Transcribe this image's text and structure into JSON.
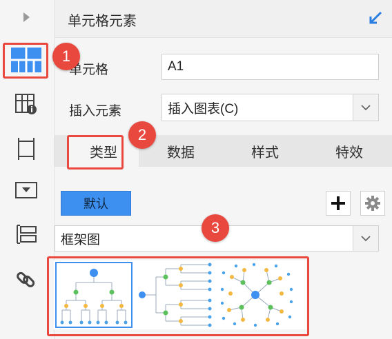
{
  "panel": {
    "title": "单元格元素"
  },
  "fields": {
    "cell_label": "单元格",
    "cell_value": "A1",
    "insert_label": "插入元素",
    "insert_value": "插入图表(C)"
  },
  "tabs": [
    {
      "label": "类型",
      "active": true
    },
    {
      "label": "数据",
      "active": false
    },
    {
      "label": "样式",
      "active": false
    },
    {
      "label": "特效",
      "active": false
    }
  ],
  "toolbar": {
    "default_label": "默认",
    "add_icon": "plus-icon",
    "settings_icon": "gear-icon"
  },
  "chart_type": {
    "value": "框架图"
  },
  "thumbnails": [
    {
      "name": "tree-top-down",
      "selected": true
    },
    {
      "name": "tree-left-right",
      "selected": false
    },
    {
      "name": "tree-radial",
      "selected": false
    }
  ],
  "badges": [
    "1",
    "2",
    "3"
  ],
  "colors": {
    "accent": "#3d8ff0",
    "callout": "#e8483d",
    "tab_bar": "#e6e6e6"
  }
}
